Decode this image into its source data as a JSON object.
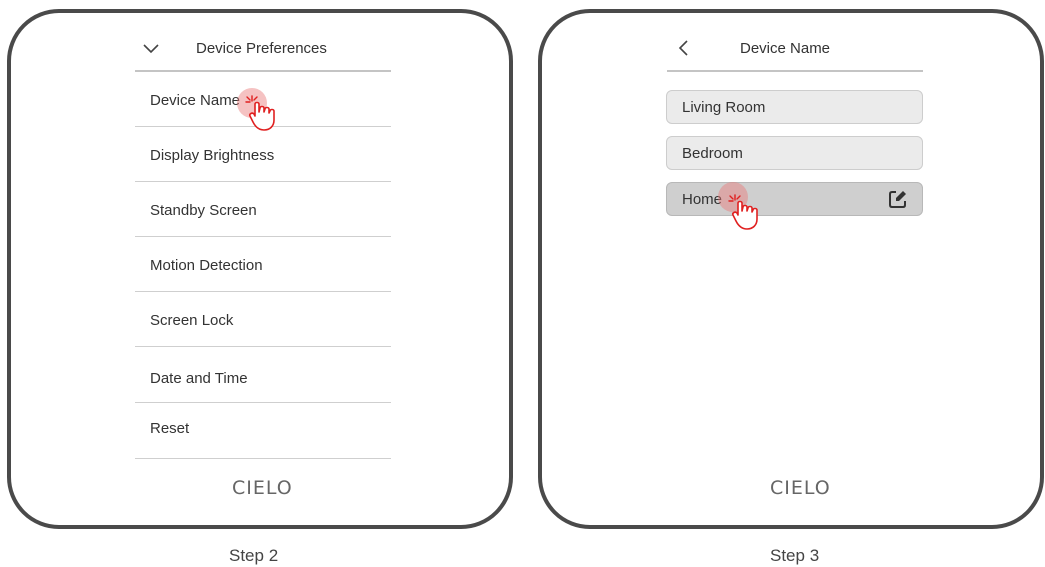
{
  "step2": {
    "header_title": "Device Preferences",
    "collapse_icon": "chevron-down-icon",
    "menu_items": [
      {
        "label": "Device Name"
      },
      {
        "label": "Display Brightness"
      },
      {
        "label": "Standby Screen"
      },
      {
        "label": "Motion Detection"
      },
      {
        "label": "Screen Lock"
      },
      {
        "label": "Date and Time"
      },
      {
        "label": "Reset"
      }
    ],
    "logo": "CIELO",
    "caption": "Step 2"
  },
  "step3": {
    "header_title": "Device Name",
    "back_icon": "chevron-left-icon",
    "options": [
      {
        "label": "Living Room"
      },
      {
        "label": "Bedroom"
      },
      {
        "label": "Home"
      }
    ],
    "edit_icon": "edit-icon",
    "logo": "CIELO",
    "caption": "Step 3"
  },
  "colors": {
    "frame": "#4a4a4a",
    "tap_highlight": "#e97878",
    "option_bg": "#ebebeb",
    "option_selected_bg": "#cfcfcf"
  }
}
